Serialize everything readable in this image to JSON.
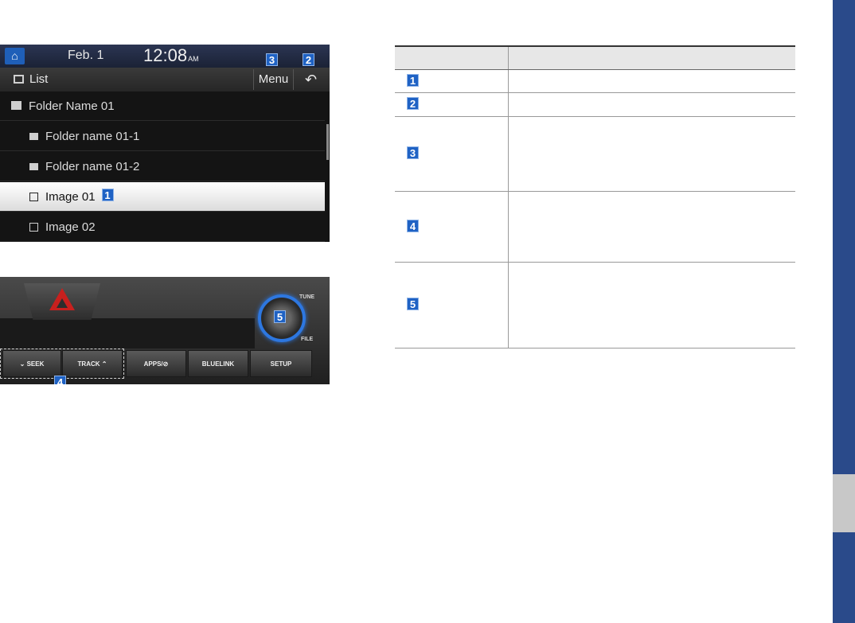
{
  "screen": {
    "status": {
      "date": "Feb. 1",
      "time": "12:08",
      "ampm": "AM"
    },
    "toolbar": {
      "title": "List",
      "menu_label": "Menu",
      "back_glyph": "↶"
    },
    "list": [
      {
        "label": "Folder Name 01",
        "type": "parent-folder"
      },
      {
        "label": "Folder name 01-1",
        "type": "folder"
      },
      {
        "label": "Folder name 01-2",
        "type": "folder"
      },
      {
        "label": "Image 01",
        "type": "image",
        "selected": true
      },
      {
        "label": "Image 02",
        "type": "image"
      }
    ]
  },
  "console": {
    "tune_label": "TUNE",
    "file_label": "FILE",
    "buttons": [
      {
        "label": "⌄ SEEK"
      },
      {
        "label": "TRACK ⌃"
      },
      {
        "label": "APPS/⊘"
      },
      {
        "label": "BLUELINK"
      },
      {
        "label": "SETUP"
      }
    ]
  },
  "callouts": [
    "1",
    "2",
    "3",
    "4",
    "5"
  ],
  "table": {
    "headers": [
      "",
      ""
    ],
    "rows": [
      {
        "num": "1",
        "text": ""
      },
      {
        "num": "2",
        "text": ""
      },
      {
        "num": "3",
        "text": ""
      },
      {
        "num": "4",
        "text": ""
      },
      {
        "num": "5",
        "text": ""
      }
    ]
  },
  "colors": {
    "callout_blue": "#1f62c4",
    "side_tab_blue": "#2a4a8a",
    "side_tab_gray": "#c8c8c8",
    "hazard_red": "#c8201e",
    "knob_ring_blue": "#2d77e0"
  }
}
